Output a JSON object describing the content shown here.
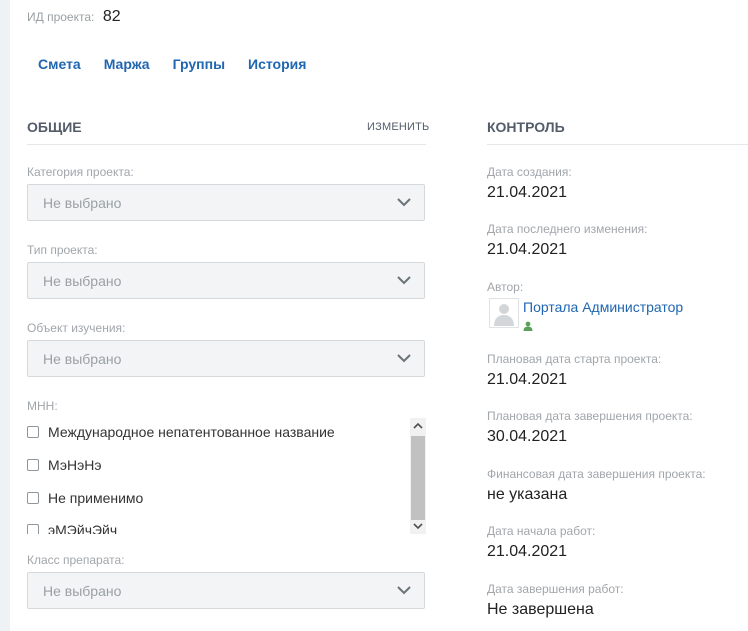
{
  "project": {
    "id_label": "ИД проекта:",
    "id_value": "82"
  },
  "tabs": [
    {
      "label": "Смета"
    },
    {
      "label": "Маржа"
    },
    {
      "label": "Группы"
    },
    {
      "label": "История"
    }
  ],
  "general": {
    "title": "ОБЩИЕ",
    "edit_label": "ИЗМЕНИТЬ",
    "fields": [
      {
        "label": "Категория проекта:",
        "value": "Не выбрано"
      },
      {
        "label": "Тип проекта:",
        "value": "Не выбрано"
      },
      {
        "label": "Объект изучения:",
        "value": "Не выбрано"
      }
    ],
    "mnn": {
      "label": "МНН:",
      "options": [
        {
          "label": "Международное непатентованное название",
          "checked": false
        },
        {
          "label": "МэНэНэ",
          "checked": false
        },
        {
          "label": "Не применимо",
          "checked": false
        },
        {
          "label": "эМЭйчЭйч",
          "checked": false
        }
      ]
    },
    "drug_class": {
      "label": "Класс препарата:",
      "value": "Не выбрано"
    }
  },
  "control": {
    "title": "КОНТРОЛЬ",
    "created_label": "Дата создания:",
    "created_value": "21.04.2021",
    "modified_label": "Дата последнего изменения:",
    "modified_value": "21.04.2021",
    "author_label": "Автор:",
    "author_name": "Портала Администратор",
    "planned_start_label": "Плановая дата старта проекта:",
    "planned_start_value": "21.04.2021",
    "planned_end_label": "Плановая дата завершения проекта:",
    "planned_end_value": "30.04.2021",
    "fin_end_label": "Финансовая дата завершения проекта:",
    "fin_end_value": "не указана",
    "work_start_label": "Дата начала работ:",
    "work_start_value": "21.04.2021",
    "work_end_label": "Дата завершения работ:",
    "work_end_value": "Не завершена"
  },
  "colors": {
    "link": "#2066b0",
    "label": "#a1a6ab",
    "section": "#535c69"
  },
  "icons": {
    "select_arrow": "chevron-down-icon",
    "avatar": "user-avatar-icon",
    "author_badge": "user-badge-icon"
  }
}
